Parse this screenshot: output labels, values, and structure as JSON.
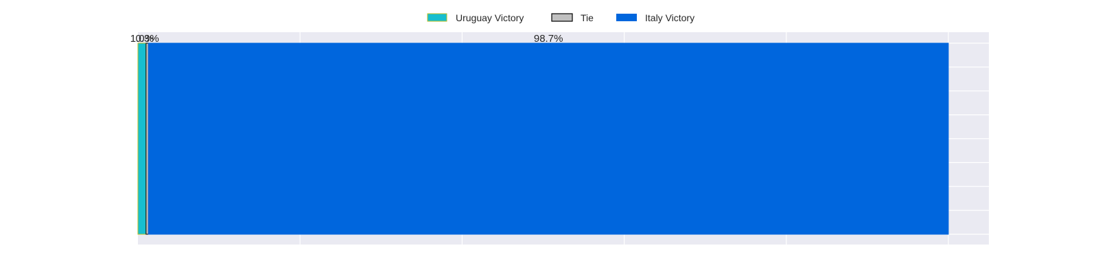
{
  "chart_data": {
    "type": "bar",
    "orientation": "horizontal",
    "stacked": true,
    "normalized_to": 100,
    "categories": [
      ""
    ],
    "series": [
      {
        "name": "Uruguay Victory",
        "values": [
          1.0
        ],
        "label": "1.0%",
        "color": "#17becf",
        "edge_color": "#bcbd22"
      },
      {
        "name": "Tie",
        "values": [
          0.3
        ],
        "label": "0.3%",
        "color": "#c0c0c0",
        "edge_color": "#000000"
      },
      {
        "name": "Italy Victory",
        "values": [
          98.7
        ],
        "label": "98.7%",
        "color": "#0066dd",
        "edge_color": "#0066dd"
      }
    ],
    "xlim": [
      0,
      105
    ],
    "grid": true,
    "legend": "top-center",
    "title": "",
    "xlabel": "",
    "ylabel": ""
  },
  "legend": {
    "items": [
      {
        "name": "Uruguay Victory",
        "label": "Uruguay Victory"
      },
      {
        "name": "Tie",
        "label": "Tie"
      },
      {
        "name": "Italy Victory",
        "label": "Italy Victory"
      }
    ]
  },
  "colors": {
    "plot_background": "#eaeaf2",
    "grid": "#ffffff",
    "text": "#262626"
  }
}
